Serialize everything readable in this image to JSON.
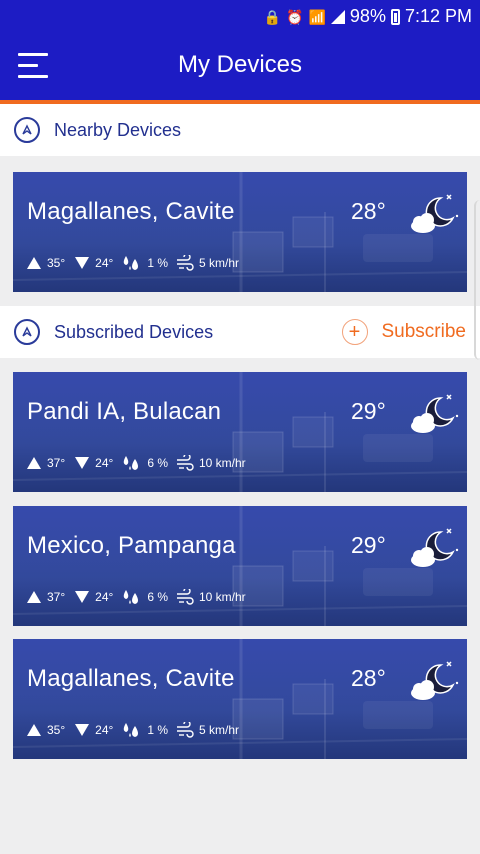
{
  "status_bar": {
    "battery": "98%",
    "time": "7:12 PM"
  },
  "app_bar": {
    "title": "My Devices"
  },
  "nearby": {
    "label": "Nearby Devices",
    "devices": [
      {
        "location": "Magallanes, Cavite",
        "temp": "28°",
        "high": "35°",
        "low": "24°",
        "rain": "1 %",
        "wind": "5 km/hr"
      }
    ]
  },
  "subscribed": {
    "label": "Subscribed Devices",
    "subscribe_label": "Subscribe",
    "devices": [
      {
        "location": "Pandi IA, Bulacan",
        "temp": "29°",
        "high": "37°",
        "low": "24°",
        "rain": "6 %",
        "wind": "10 km/hr"
      },
      {
        "location": "Mexico, Pampanga",
        "temp": "29°",
        "high": "37°",
        "low": "24°",
        "rain": "6 %",
        "wind": "10 km/hr"
      },
      {
        "location": "Magallanes, Cavite",
        "temp": "28°",
        "high": "35°",
        "low": "24°",
        "rain": "1 %",
        "wind": "5 km/hr"
      }
    ]
  },
  "colors": {
    "primary": "#1d1cc4",
    "accent": "#f06b20",
    "section_text": "#22308f"
  },
  "icons": {
    "menu": "hamburger-menu-icon",
    "section": "compass-icon",
    "subscribe": "plus-circle-icon",
    "weather": "moon-cloud-night-icon",
    "high": "triangle-up-icon",
    "low": "triangle-down-icon",
    "rain": "raindrops-icon",
    "wind": "wind-icon"
  }
}
